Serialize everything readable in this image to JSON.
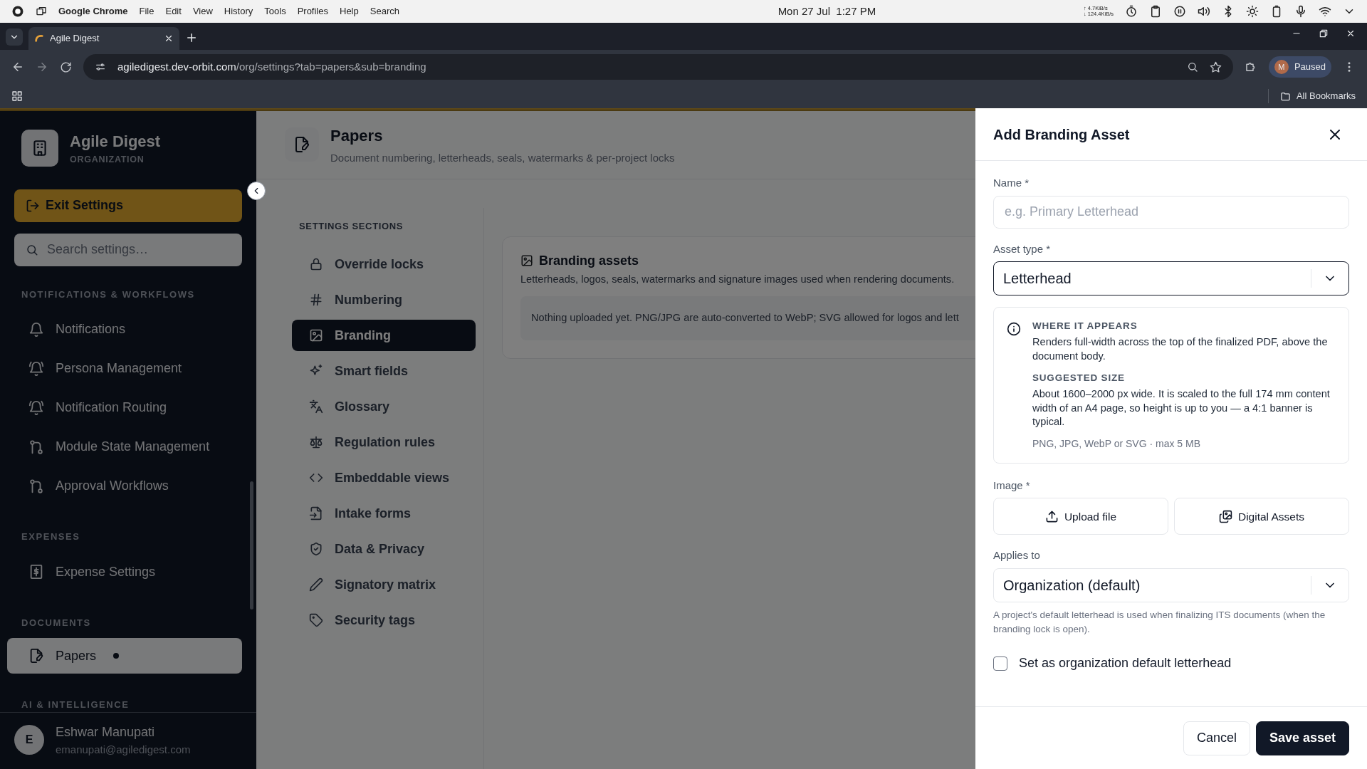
{
  "os_bar": {
    "app": "Google Chrome",
    "menus": [
      "File",
      "Edit",
      "View",
      "History",
      "Tools",
      "Profiles",
      "Help",
      "Search"
    ],
    "clock": "Mon 27 Jul  1:27 PM",
    "net_up": "↑ 4.7KiB/s",
    "net_down": "↓ 124.4KiB/s"
  },
  "browser": {
    "tabs": [
      {
        "title": "Agile Digest",
        "selected": true
      }
    ],
    "url": "agiledigest.dev-orbit.com/org/settings?tab=papers&sub=branding",
    "profile": {
      "initial": "M",
      "status": "Paused"
    },
    "bookmarks": "All Bookmarks"
  },
  "sidebar": {
    "org_name": "Agile Digest",
    "org_type": "ORGANIZATION",
    "exit_button": "Exit Settings",
    "search": {
      "placeholder": "Search settings…"
    },
    "groups": [
      {
        "label": "NOTIFICATIONS & WORKFLOWS",
        "items": [
          {
            "label": "Notifications",
            "selected": false
          },
          {
            "label": "Persona Management",
            "selected": false
          },
          {
            "label": "Notification Routing",
            "selected": false
          },
          {
            "label": "Module State Management",
            "selected": false
          },
          {
            "label": "Approval Workflows",
            "selected": false
          }
        ]
      },
      {
        "label": "EXPENSES",
        "items": [
          {
            "label": "Expense Settings",
            "selected": false
          }
        ]
      },
      {
        "label": "DOCUMENTS",
        "items": [
          {
            "label": "Papers",
            "selected": true,
            "marked": true
          }
        ]
      },
      {
        "label": "AI & INTELLIGENCE"
      }
    ],
    "user": {
      "initial": "E",
      "name": "Eshwar Manupati",
      "email": "emanupati@agiledigest.com"
    }
  },
  "page_header": {
    "title": "Papers",
    "subtitle": "Document numbering, letterheads, seals, watermarks & per-project locks"
  },
  "sections": {
    "heading": "SETTINGS SECTIONS",
    "items": [
      {
        "label": "Override locks",
        "selected": false
      },
      {
        "label": "Numbering",
        "selected": false
      },
      {
        "label": "Branding",
        "selected": true
      },
      {
        "label": "Smart fields",
        "selected": false
      },
      {
        "label": "Glossary",
        "selected": false
      },
      {
        "label": "Regulation rules",
        "selected": false
      },
      {
        "label": "Embeddable views",
        "selected": false
      },
      {
        "label": "Intake forms",
        "selected": false
      },
      {
        "label": "Data & Privacy",
        "selected": false
      },
      {
        "label": "Signatory matrix",
        "selected": false
      },
      {
        "label": "Security tags",
        "selected": false
      }
    ]
  },
  "card": {
    "title": "Branding assets",
    "description": "Letterheads, logos, seals, watermarks and signature images used when rendering documents.",
    "notice": "Nothing uploaded yet. PNG/JPG are auto-converted to WebP; SVG allowed for logos and lett"
  },
  "drawer": {
    "title": "Add Branding Asset",
    "name_field": {
      "label": "Name *",
      "placeholder": "e.g. Primary Letterhead"
    },
    "asset_type": {
      "label": "Asset type *",
      "value": "Letterhead",
      "focused": true
    },
    "info": {
      "sections": [
        {
          "heading": "WHERE IT APPEARS",
          "text": "Renders full-width across the top of the finalized PDF, above the document body."
        },
        {
          "heading": "SUGGESTED SIZE",
          "text": "About 1600–2000 px wide. It is scaled to the full 174 mm content width of an A4 page, so height is up to you — a 4:1 banner is typical."
        }
      ],
      "note": "PNG, JPG, WebP or SVG · max 5 MB"
    },
    "image": {
      "label": "Image *",
      "buttons": [
        "Upload file",
        "Digital Assets"
      ]
    },
    "applies_to": {
      "label": "Applies to",
      "value": "Organization (default)",
      "focused": false,
      "help": "A project's default letterhead is used when finalizing ITS documents (when the branding lock is open)."
    },
    "checkbox": {
      "label": "Set as organization default letterhead",
      "checked": false
    },
    "buttons": [
      {
        "label": "Cancel",
        "kind": "secondary"
      },
      {
        "label": "Save asset",
        "kind": "primary"
      }
    ]
  }
}
